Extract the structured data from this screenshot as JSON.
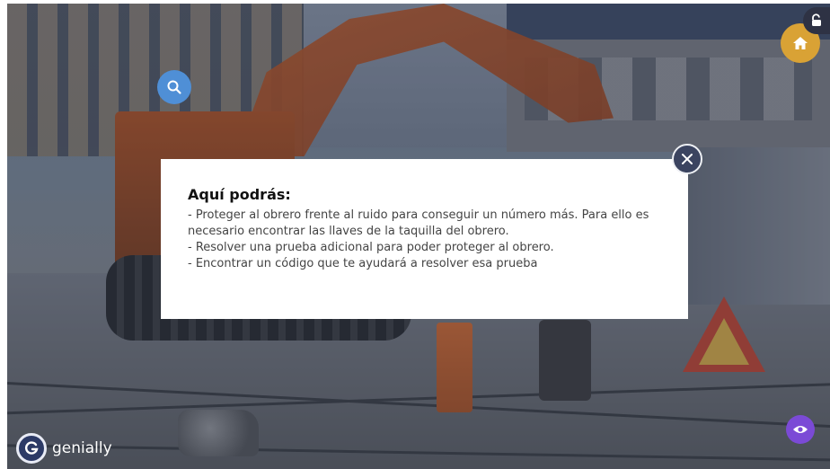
{
  "modal": {
    "title": "Aquí podrás:",
    "lines": [
      "- Proteger al obrero frente al ruido para conseguir un número más. Para ello es",
      "necesario encontrar las llaves de la taquilla del obrero.",
      "- Resolver una prueba adicional para poder proteger al obrero.",
      "- Encontrar un código que te ayudará a resolver esa prueba"
    ]
  },
  "brand": {
    "name": "genially"
  },
  "icons": {
    "search": "search-icon",
    "home": "home-icon",
    "lock": "unlock-icon",
    "close": "close-icon",
    "eye": "eye-icon",
    "brand": "genially-logo-icon"
  },
  "colors": {
    "search_button": "#4f8fd6",
    "home_button": "#d9a235",
    "eye_button": "#7b4ad6",
    "close_button": "#3b4460",
    "modal_background": "#ffffff"
  }
}
